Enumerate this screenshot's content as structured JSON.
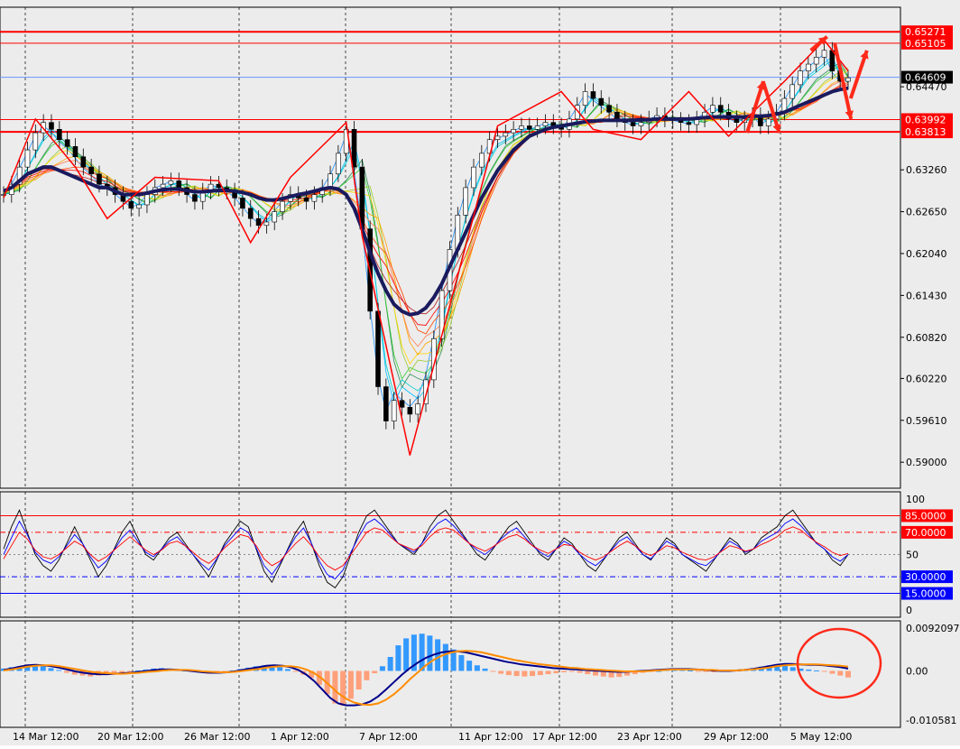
{
  "chart_data": [
    {
      "panel": "price",
      "type": "candlestick",
      "ylim": [
        0.587,
        0.6555
      ],
      "y_ticks": [
        "0.64470",
        "0.63260",
        "0.62650",
        "0.62040",
        "0.61430",
        "0.60820",
        "0.60220",
        "0.59610",
        "0.59000"
      ],
      "price_levels": [
        {
          "value": 0.65271,
          "label": "0.65271",
          "color": "#ff0000",
          "style": "thick"
        },
        {
          "value": 0.65105,
          "label": "0.65105",
          "color": "#ff0000",
          "style": "thin"
        },
        {
          "value": 0.64609,
          "label": "0.64609",
          "color": "#000000",
          "style": "current"
        },
        {
          "value": 0.63992,
          "label": "0.63992",
          "color": "#ff0000",
          "style": "thin"
        },
        {
          "value": 0.63813,
          "label": "0.63813",
          "color": "#ff0000",
          "style": "thick"
        }
      ],
      "candles_close": [
        0.629,
        0.6305,
        0.633,
        0.6355,
        0.638,
        0.6395,
        0.6385,
        0.637,
        0.636,
        0.6345,
        0.633,
        0.632,
        0.6305,
        0.63,
        0.629,
        0.628,
        0.627,
        0.6275,
        0.629,
        0.63,
        0.6305,
        0.631,
        0.63,
        0.629,
        0.628,
        0.6295,
        0.6305,
        0.63,
        0.6295,
        0.6285,
        0.627,
        0.6255,
        0.6245,
        0.625,
        0.6265,
        0.628,
        0.629,
        0.6285,
        0.628,
        0.629,
        0.63,
        0.632,
        0.635,
        0.6385,
        0.633,
        0.624,
        0.612,
        0.601,
        0.596,
        0.599,
        0.598,
        0.597,
        0.5985,
        0.602,
        0.608,
        0.615,
        0.621,
        0.626,
        0.63,
        0.633,
        0.635,
        0.637,
        0.6375,
        0.638,
        0.6385,
        0.639,
        0.6385,
        0.639,
        0.6395,
        0.639,
        0.6385,
        0.64,
        0.642,
        0.644,
        0.643,
        0.642,
        0.641,
        0.64,
        0.6395,
        0.639,
        0.6395,
        0.64,
        0.6405,
        0.64,
        0.6398,
        0.6395,
        0.6392,
        0.64,
        0.641,
        0.642,
        0.641,
        0.64,
        0.6395,
        0.64,
        0.6405,
        0.639,
        0.64,
        0.641,
        0.643,
        0.645,
        0.647,
        0.648,
        0.649,
        0.65,
        0.647,
        0.6455,
        0.646
      ],
      "ribbon_ma_heavy": [
        0.6295,
        0.63,
        0.631,
        0.632,
        0.6325,
        0.633,
        0.633,
        0.6325,
        0.632,
        0.6315,
        0.631,
        0.6305,
        0.63,
        0.63,
        0.6295,
        0.629,
        0.629,
        0.629,
        0.6292,
        0.6295,
        0.6297,
        0.6298,
        0.6298,
        0.6296,
        0.6294,
        0.6294,
        0.6295,
        0.6296,
        0.6296,
        0.6295,
        0.6293,
        0.629,
        0.6285,
        0.6282,
        0.6282,
        0.6284,
        0.6287,
        0.629,
        0.6292,
        0.6295,
        0.6298,
        0.63,
        0.6298,
        0.629,
        0.627,
        0.624,
        0.6205,
        0.6175,
        0.615,
        0.613,
        0.612,
        0.6115,
        0.6117,
        0.6125,
        0.614,
        0.616,
        0.6185,
        0.621,
        0.6235,
        0.626,
        0.6285,
        0.6305,
        0.6325,
        0.634,
        0.6355,
        0.6365,
        0.6375,
        0.638,
        0.6385,
        0.6388,
        0.639,
        0.6392,
        0.6394,
        0.6396,
        0.6397,
        0.6398,
        0.6398,
        0.6398,
        0.6398,
        0.6398,
        0.6399,
        0.6399,
        0.64,
        0.64,
        0.64,
        0.64,
        0.64,
        0.6401,
        0.6402,
        0.6403,
        0.6403,
        0.6403,
        0.6403,
        0.6403,
        0.6404,
        0.6404,
        0.6405,
        0.6407,
        0.641,
        0.6415,
        0.642,
        0.6425,
        0.643,
        0.6435,
        0.644,
        0.6443,
        0.6445
      ],
      "zigzag": [
        [
          0,
          0.6285
        ],
        [
          4,
          0.64
        ],
        [
          9,
          0.633
        ],
        [
          13,
          0.6255
        ],
        [
          19,
          0.6315
        ],
        [
          27,
          0.631
        ],
        [
          31,
          0.622
        ],
        [
          36,
          0.6315
        ],
        [
          43,
          0.6395
        ],
        [
          45,
          0.623
        ],
        [
          51,
          0.591
        ],
        [
          62,
          0.639
        ],
        [
          70,
          0.644
        ],
        [
          74,
          0.6385
        ],
        [
          80,
          0.637
        ],
        [
          86,
          0.644
        ],
        [
          91,
          0.6375
        ],
        [
          98,
          0.6455
        ],
        [
          103,
          0.6515
        ],
        [
          106,
          0.647
        ]
      ],
      "arrows": [
        [
          94,
          0.638,
          0.6455
        ],
        [
          96,
          0.6455,
          0.638
        ],
        [
          102,
          0.65,
          0.652
        ],
        [
          105,
          0.651,
          0.64
        ],
        [
          107,
          0.643,
          0.65
        ]
      ],
      "x_ticks": [
        "14 Mar 12:00",
        "20 Mar 12:00",
        "26 Mar 12:00",
        "1 Apr 12:00",
        "7 Apr 12:00",
        "11 Apr 12:00",
        "17 Apr 12:00",
        "23 Apr 12:00",
        "29 Apr 12:00",
        "5 May 12:00"
      ]
    },
    {
      "panel": "stochastic",
      "type": "line",
      "ylim": [
        0,
        100
      ],
      "y_ticks": [
        "100",
        "50",
        "0"
      ],
      "levels": [
        {
          "value": 85,
          "label": "85.0000",
          "color": "#ff0000"
        },
        {
          "value": 70,
          "label": "70.0000",
          "color": "#ff0000"
        },
        {
          "value": 30,
          "label": "30.0000",
          "color": "#0000ff"
        },
        {
          "value": 15,
          "label": "15.0000",
          "color": "#0000ff"
        }
      ],
      "series": [
        {
          "color": "#000000",
          "values": [
            55,
            75,
            90,
            70,
            50,
            40,
            35,
            45,
            60,
            75,
            60,
            45,
            30,
            40,
            55,
            70,
            80,
            65,
            50,
            45,
            55,
            65,
            70,
            60,
            50,
            40,
            30,
            45,
            60,
            70,
            80,
            75,
            55,
            35,
            25,
            40,
            55,
            70,
            80,
            60,
            40,
            25,
            20,
            30,
            50,
            70,
            85,
            90,
            80,
            70,
            60,
            55,
            50,
            60,
            75,
            85,
            90,
            80,
            70,
            60,
            50,
            45,
            55,
            65,
            75,
            80,
            70,
            60,
            50,
            45,
            55,
            65,
            60,
            50,
            40,
            35,
            45,
            55,
            65,
            70,
            60,
            50,
            45,
            55,
            65,
            60,
            50,
            45,
            40,
            35,
            45,
            55,
            65,
            60,
            50,
            55,
            65,
            70,
            75,
            85,
            90,
            80,
            70,
            60,
            55,
            45,
            40,
            50
          ]
        },
        {
          "color": "#0000ff",
          "values": [
            50,
            65,
            80,
            68,
            52,
            45,
            42,
            48,
            58,
            68,
            60,
            48,
            38,
            44,
            54,
            65,
            72,
            62,
            52,
            48,
            55,
            62,
            66,
            58,
            50,
            42,
            36,
            46,
            58,
            66,
            74,
            70,
            56,
            40,
            32,
            42,
            54,
            66,
            74,
            60,
            44,
            32,
            28,
            36,
            52,
            66,
            78,
            82,
            76,
            68,
            60,
            56,
            52,
            60,
            70,
            78,
            82,
            76,
            68,
            60,
            54,
            50,
            56,
            64,
            70,
            74,
            66,
            58,
            52,
            48,
            55,
            62,
            58,
            50,
            44,
            40,
            46,
            54,
            62,
            66,
            58,
            50,
            46,
            54,
            62,
            58,
            50,
            46,
            42,
            40,
            46,
            54,
            62,
            58,
            52,
            55,
            62,
            66,
            70,
            78,
            82,
            76,
            68,
            60,
            55,
            48,
            44,
            50
          ]
        },
        {
          "color": "#ff0000",
          "values": [
            46,
            58,
            70,
            64,
            54,
            48,
            46,
            50,
            56,
            62,
            58,
            50,
            44,
            48,
            54,
            60,
            66,
            60,
            54,
            50,
            54,
            60,
            62,
            58,
            52,
            46,
            42,
            48,
            56,
            62,
            68,
            66,
            58,
            46,
            40,
            44,
            52,
            60,
            66,
            58,
            48,
            40,
            36,
            40,
            50,
            60,
            70,
            74,
            72,
            66,
            60,
            57,
            54,
            58,
            66,
            72,
            74,
            72,
            66,
            60,
            56,
            53,
            57,
            62,
            66,
            68,
            64,
            58,
            54,
            51,
            55,
            59,
            58,
            52,
            48,
            45,
            48,
            53,
            58,
            62,
            58,
            52,
            49,
            53,
            58,
            56,
            52,
            49,
            46,
            45,
            48,
            53,
            58,
            56,
            53,
            55,
            59,
            62,
            66,
            72,
            75,
            72,
            66,
            61,
            57,
            52,
            49,
            51
          ]
        }
      ]
    },
    {
      "panel": "macd",
      "type": "bar",
      "ylim": [
        -0.010581,
        0.0092097
      ],
      "y_ticks": [
        "0.0092097",
        "0.00",
        "-0.010581"
      ],
      "histogram": [
        0.0005,
        0.0008,
        0.001,
        0.0011,
        0.0012,
        0.001,
        0.0006,
        0.0002,
        -0.0004,
        -0.0008,
        -0.001,
        -0.0012,
        -0.001,
        -0.0008,
        -0.0006,
        -0.0004,
        -0.0002,
        0.0001,
        0.0003,
        0.0005,
        0.0006,
        0.0005,
        0.0003,
        0.0001,
        -0.0002,
        -0.0004,
        -0.0006,
        -0.0005,
        -0.0003,
        0.0001,
        0.0004,
        0.0007,
        0.001,
        0.0012,
        0.0011,
        0.0008,
        0.0004,
        -0.0002,
        -0.0008,
        -0.0015,
        -0.003,
        -0.005,
        -0.007,
        -0.0075,
        -0.006,
        -0.004,
        -0.002,
        -0.0005,
        0.001,
        0.003,
        0.0055,
        0.007,
        0.0078,
        0.008,
        0.0076,
        0.0068,
        0.0058,
        0.0046,
        0.0034,
        0.0022,
        0.0012,
        0.0005,
        -0.0002,
        -0.0006,
        -0.0009,
        -0.0011,
        -0.0012,
        -0.0011,
        -0.0009,
        -0.0007,
        -0.0005,
        -0.0003,
        -0.0002,
        -0.0004,
        -0.0007,
        -0.001,
        -0.0012,
        -0.0014,
        -0.0013,
        -0.001,
        -0.0007,
        -0.0004,
        -0.0002,
        0.0,
        0.0002,
        0.0003,
        0.0002,
        0.0001,
        -0.0001,
        -0.0002,
        -0.0003,
        -0.0002,
        -0.0001,
        0.0001,
        0.0003,
        0.0006,
        0.0009,
        0.0012,
        0.0013,
        0.0011,
        0.0008,
        0.0005,
        0.0003,
        0.0001,
        -0.0002,
        -0.0006,
        -0.001,
        -0.0014
      ],
      "series": [
        {
          "color": "#00008b",
          "values": [
            0.0002,
            0.0005,
            0.0009,
            0.0012,
            0.0013,
            0.0012,
            0.001,
            0.0007,
            0.0003,
            -0.0001,
            -0.0004,
            -0.0006,
            -0.0007,
            -0.0007,
            -0.0006,
            -0.0005,
            -0.0004,
            -0.0002,
            0.0,
            0.0002,
            0.0003,
            0.0003,
            0.0002,
            0.0001,
            -0.0001,
            -0.0003,
            -0.0004,
            -0.0004,
            -0.0003,
            -0.0001,
            0.0002,
            0.0005,
            0.0008,
            0.0011,
            0.0012,
            0.0011,
            0.0008,
            0.0002,
            -0.0008,
            -0.0022,
            -0.004,
            -0.0058,
            -0.007,
            -0.0074,
            -0.0074,
            -0.0072,
            -0.0066,
            -0.0055,
            -0.004,
            -0.0024,
            -0.0008,
            0.0006,
            0.0018,
            0.0028,
            0.0035,
            0.004,
            0.0042,
            0.0042,
            0.004,
            0.0036,
            0.0032,
            0.0028,
            0.0024,
            0.002,
            0.0017,
            0.0014,
            0.0012,
            0.001,
            0.0008,
            0.0006,
            0.0005,
            0.0004,
            0.0003,
            0.0002,
            0.0001,
            0.0,
            -0.0001,
            -0.0002,
            -0.0002,
            -0.0001,
            0.0,
            0.0001,
            0.0002,
            0.0003,
            0.0004,
            0.0004,
            0.0004,
            0.0003,
            0.0002,
            0.0001,
            0.0,
            0.0,
            0.0001,
            0.0002,
            0.0004,
            0.0007,
            0.001,
            0.0013,
            0.0015,
            0.0015,
            0.0014,
            0.0013,
            0.0013,
            0.0012,
            0.001,
            0.0008,
            0.0005
          ]
        },
        {
          "color": "#ff8c00",
          "values": [
            0.0001,
            0.0003,
            0.0006,
            0.0009,
            0.0011,
            0.0012,
            0.0012,
            0.001,
            0.0007,
            0.0004,
            0.0001,
            -0.0002,
            -0.0004,
            -0.0005,
            -0.0006,
            -0.0006,
            -0.0005,
            -0.0004,
            -0.0002,
            -0.0001,
            0.0001,
            0.0002,
            0.0002,
            0.0002,
            0.0001,
            -0.0001,
            -0.0002,
            -0.0003,
            -0.0003,
            -0.0002,
            0.0,
            0.0002,
            0.0004,
            0.0007,
            0.0009,
            0.001,
            0.001,
            0.0008,
            0.0003,
            -0.0005,
            -0.0017,
            -0.0032,
            -0.0048,
            -0.006,
            -0.0068,
            -0.0072,
            -0.0073,
            -0.007,
            -0.0062,
            -0.005,
            -0.0035,
            -0.0018,
            -0.0003,
            0.0012,
            0.0024,
            0.0033,
            0.0039,
            0.0042,
            0.0043,
            0.0042,
            0.004,
            0.0036,
            0.0032,
            0.0028,
            0.0024,
            0.0021,
            0.0018,
            0.0015,
            0.0013,
            0.0011,
            0.0009,
            0.0007,
            0.0006,
            0.0004,
            0.0003,
            0.0002,
            0.0001,
            0.0,
            -0.0001,
            -0.0001,
            -0.0001,
            0.0,
            0.0001,
            0.0002,
            0.0003,
            0.0003,
            0.0003,
            0.0003,
            0.0002,
            0.0002,
            0.0001,
            0.0001,
            0.0001,
            0.0002,
            0.0003,
            0.0005,
            0.0007,
            0.001,
            0.0012,
            0.0013,
            0.0014,
            0.0014,
            0.0014,
            0.0013,
            0.0012,
            0.0011,
            0.0009
          ]
        }
      ]
    }
  ]
}
